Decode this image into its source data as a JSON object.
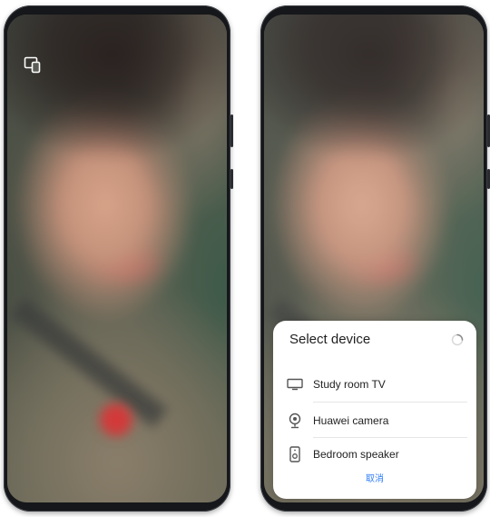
{
  "left_phone": {
    "cast_icon": "screen-cast-icon"
  },
  "right_phone": {
    "dialog": {
      "title": "Select device",
      "loading_icon": "spinner-icon",
      "devices": [
        {
          "label": "Study room TV",
          "icon": "tv-icon"
        },
        {
          "label": "Huawei camera",
          "icon": "camera-icon"
        },
        {
          "label": "Bedroom speaker",
          "icon": "speaker-icon"
        }
      ],
      "cancel_label": "取消"
    }
  },
  "colors": {
    "accent": "#2f7df6",
    "phone_frame": "#15171a",
    "sheet_bg": "#ffffff"
  }
}
